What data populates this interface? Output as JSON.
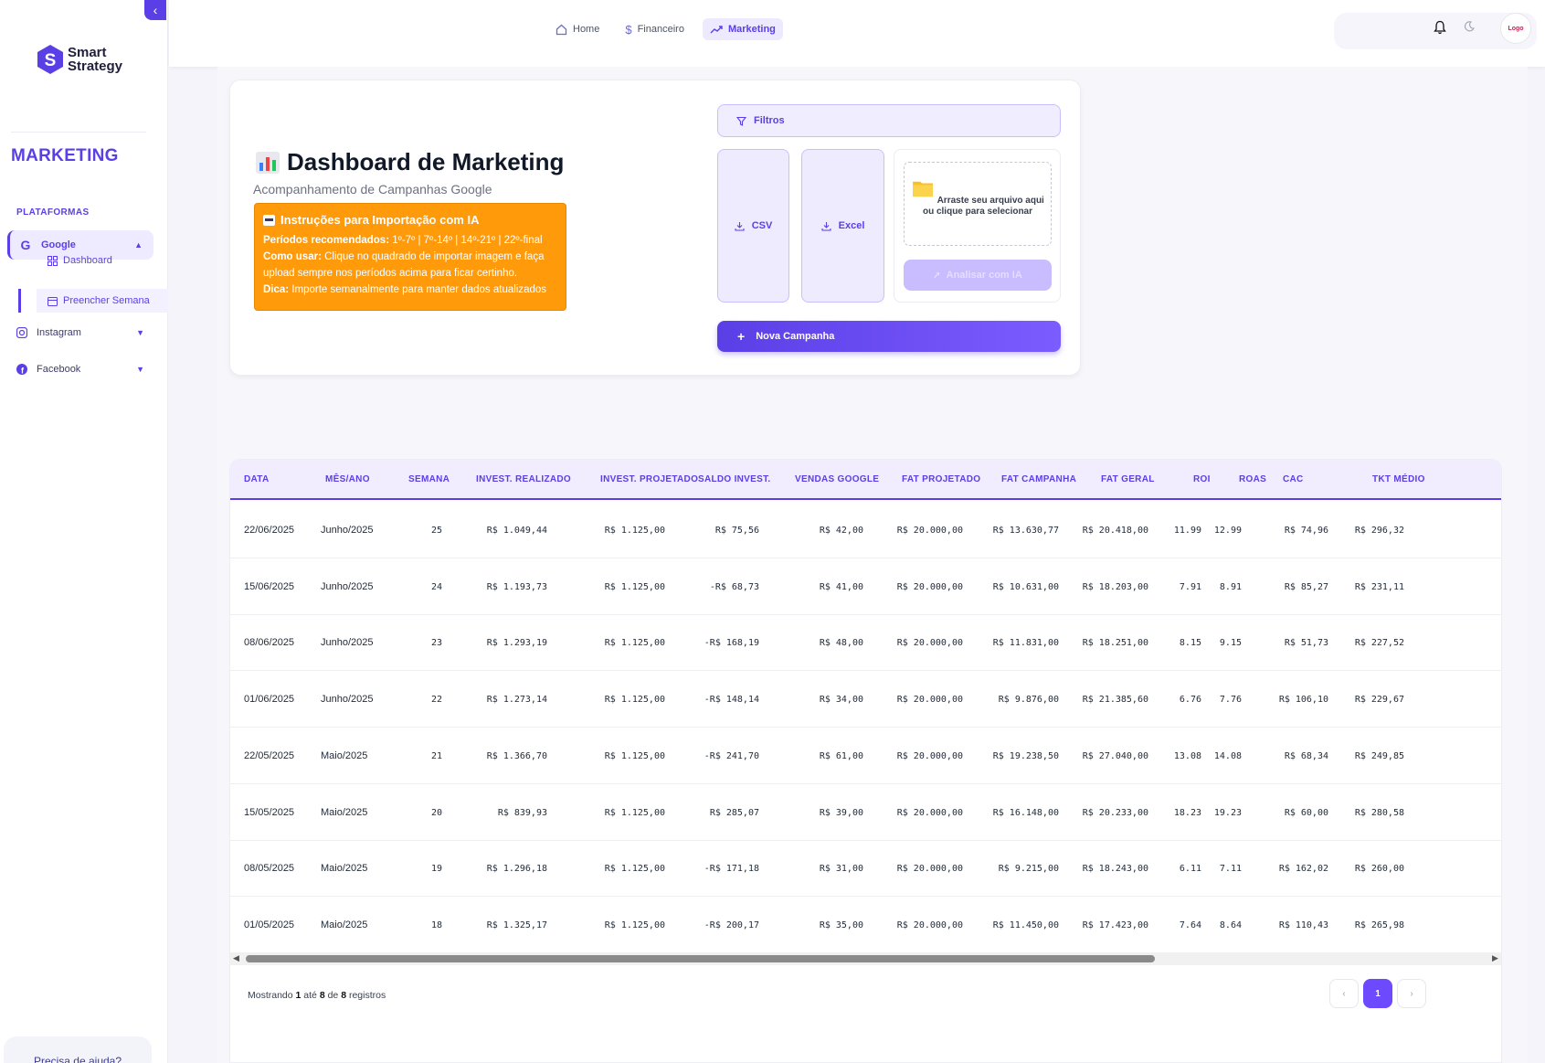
{
  "sidebar": {
    "logo_line1": "Smart",
    "logo_line2": "Strategy",
    "title": "MARKETING",
    "section": "PLATAFORMAS",
    "google_label": "Google",
    "sub_dashboard": "Dashboard",
    "sub_preencher": "Preencher Semana",
    "instagram_label": "Instagram",
    "facebook_label": "Facebook",
    "help": "Precisa de ajuda?"
  },
  "topnav": {
    "home": "Home",
    "financeiro": "Financeiro",
    "marketing": "Marketing"
  },
  "header": {
    "title": "Dashboard de Marketing",
    "subtitle": "Acompanhamento de Campanhas Google",
    "instr_title": "Instruções para Importação com IA",
    "instr_p1_label": "Períodos recomendados:",
    "instr_p1_text": " 1º-7º | 7º-14º | 14º-21º | 22º-final",
    "instr_p2_label": "Como usar:",
    "instr_p2_text": " Clique no quadrado de importar imagem e faça upload sempre nos períodos acima para ficar certinho.",
    "instr_p3_label": "Dica:",
    "instr_p3_text": " Importe semanalmente para manter dados atualizados",
    "filters": "Filtros",
    "csv": "CSV",
    "excel": "Excel",
    "drop_text": "Arraste seu arquivo aqui ou clique para selecionar",
    "analisar": "Analisar com IA",
    "nova": "Nova Campanha"
  },
  "table": {
    "headers": [
      "DATA",
      "MÊS/ANO",
      "SEMANA",
      "INVEST. REALIZADO",
      "INVEST. PROJETADO",
      "SALDO INVEST.",
      "VENDAS GOOGLE",
      "FAT PROJETADO",
      "FAT CAMPANHA",
      "FAT GERAL",
      "ROI",
      "ROAS",
      "CAC",
      "TKT MÉDIO"
    ],
    "rows": [
      [
        "22/06/2025",
        "Junho/2025",
        "25",
        "R$ 1.049,44",
        "R$ 1.125,00",
        "R$ 75,56",
        "R$ 42,00",
        "R$ 20.000,00",
        "R$ 13.630,77",
        "R$ 20.418,00",
        "11.99",
        "12.99",
        "R$ 74,96",
        "R$ 296,32"
      ],
      [
        "15/06/2025",
        "Junho/2025",
        "24",
        "R$ 1.193,73",
        "R$ 1.125,00",
        "-R$ 68,73",
        "R$ 41,00",
        "R$ 20.000,00",
        "R$ 10.631,00",
        "R$ 18.203,00",
        "7.91",
        "8.91",
        "R$ 85,27",
        "R$ 231,11"
      ],
      [
        "08/06/2025",
        "Junho/2025",
        "23",
        "R$ 1.293,19",
        "R$ 1.125,00",
        "-R$ 168,19",
        "R$ 48,00",
        "R$ 20.000,00",
        "R$ 11.831,00",
        "R$ 18.251,00",
        "8.15",
        "9.15",
        "R$ 51,73",
        "R$ 227,52"
      ],
      [
        "01/06/2025",
        "Junho/2025",
        "22",
        "R$ 1.273,14",
        "R$ 1.125,00",
        "-R$ 148,14",
        "R$ 34,00",
        "R$ 20.000,00",
        "R$ 9.876,00",
        "R$ 21.385,60",
        "6.76",
        "7.76",
        "R$ 106,10",
        "R$ 229,67"
      ],
      [
        "22/05/2025",
        "Maio/2025",
        "21",
        "R$ 1.366,70",
        "R$ 1.125,00",
        "-R$ 241,70",
        "R$ 61,00",
        "R$ 20.000,00",
        "R$ 19.238,50",
        "R$ 27.040,00",
        "13.08",
        "14.08",
        "R$ 68,34",
        "R$ 249,85"
      ],
      [
        "15/05/2025",
        "Maio/2025",
        "20",
        "R$ 839,93",
        "R$ 1.125,00",
        "R$ 285,07",
        "R$ 39,00",
        "R$ 20.000,00",
        "R$ 16.148,00",
        "R$ 20.233,00",
        "18.23",
        "19.23",
        "R$ 60,00",
        "R$ 280,58"
      ],
      [
        "08/05/2025",
        "Maio/2025",
        "19",
        "R$ 1.296,18",
        "R$ 1.125,00",
        "-R$ 171,18",
        "R$ 31,00",
        "R$ 20.000,00",
        "R$ 9.215,00",
        "R$ 18.243,00",
        "6.11",
        "7.11",
        "R$ 162,02",
        "R$ 260,00"
      ],
      [
        "01/05/2025",
        "Maio/2025",
        "18",
        "R$ 1.325,17",
        "R$ 1.125,00",
        "-R$ 200,17",
        "R$ 35,00",
        "R$ 20.000,00",
        "R$ 11.450,00",
        "R$ 17.423,00",
        "7.64",
        "8.64",
        "R$ 110,43",
        "R$ 265,98"
      ]
    ]
  },
  "footer": {
    "mostrando": "Mostrando",
    "from": "1",
    "ate": "até",
    "to": "8",
    "de": "de",
    "total": "8",
    "registros": "registros",
    "page": "1",
    "prev": "‹",
    "next": "›"
  },
  "avatar_text": "Logo",
  "colors": {
    "accent": "#5b3fe6",
    "instructions": "#ff9a0a"
  }
}
